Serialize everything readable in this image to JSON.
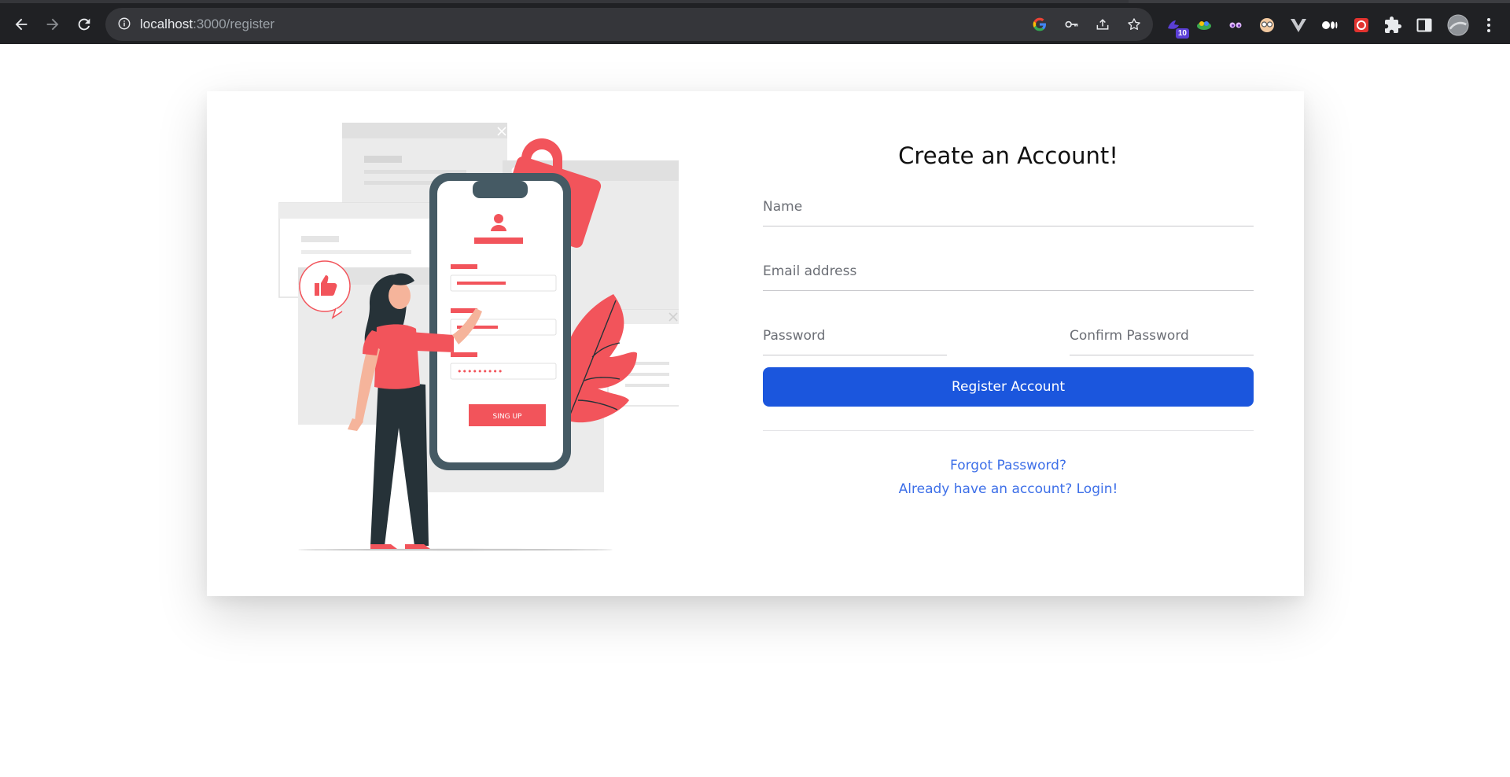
{
  "browser": {
    "url_host": "localhost",
    "url_path": ":3000/register",
    "extension_badge": "10"
  },
  "page": {
    "title": "Create an Account!",
    "fields": {
      "name_placeholder": "Name",
      "email_placeholder": "Email address",
      "password_placeholder": "Password",
      "confirm_placeholder": "Confirm Password"
    },
    "register_label": "Register Account",
    "forgot_link": "Forgot Password?",
    "login_link": "Already have an account? Login!",
    "illustration": {
      "signup_button_text": "SING UP",
      "masked_password": "•••••••••"
    }
  },
  "colors": {
    "accent_button": "#1b56dd",
    "link": "#3d6fe8",
    "illustration_red": "#f2545b",
    "illustration_dark": "#263238"
  }
}
